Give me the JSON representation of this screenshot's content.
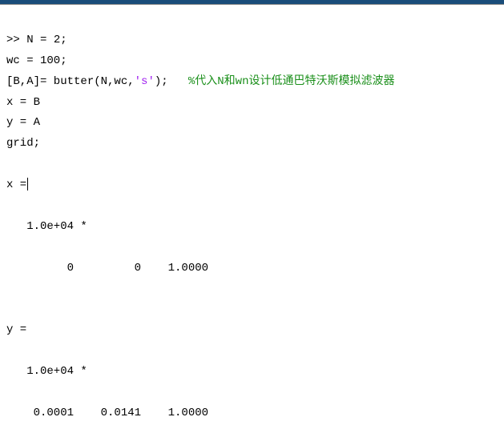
{
  "input": {
    "prompt": ">> ",
    "line1": "N = 2;",
    "line2": "wc = 100;",
    "line3a": "[B,A]= butter(N,wc,",
    "line3str": "'s'",
    "line3b": ");   ",
    "line3comment": "%代入N和wn设计低通巴特沃斯模拟滤波器",
    "line4": "x = B",
    "line5": "y = A",
    "line6": "grid;"
  },
  "output": {
    "x_header": "x =",
    "x_scale": "   1.0e+04 *",
    "x_values": "         0         0    1.0000",
    "y_header": "y =",
    "y_scale": "   1.0e+04 *",
    "y_values": "    0.0001    0.0141    1.0000"
  },
  "chart_data": {
    "type": "table",
    "title": "MATLAB butter() output coefficients",
    "variables": [
      {
        "name": "x",
        "scale": "1.0e+04",
        "values": [
          0,
          0,
          1.0
        ]
      },
      {
        "name": "y",
        "scale": "1.0e+04",
        "values": [
          0.0001,
          0.0141,
          1.0
        ]
      }
    ]
  }
}
